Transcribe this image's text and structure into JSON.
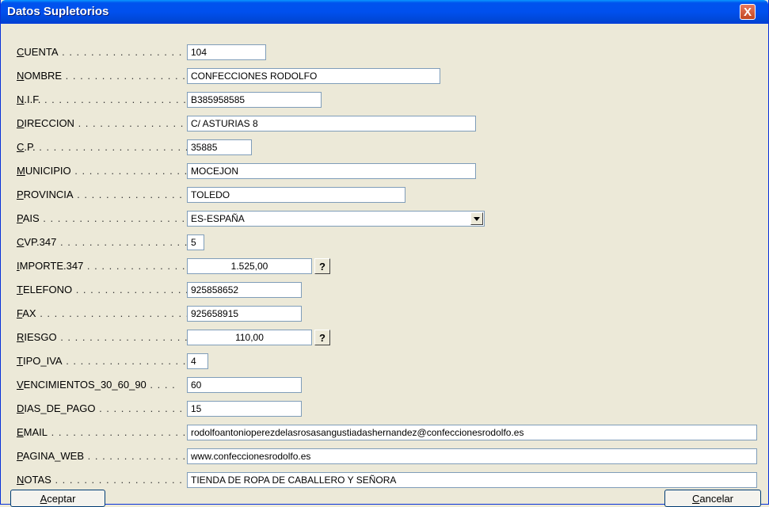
{
  "window": {
    "title": "Datos Supletorios",
    "close_glyph": "X"
  },
  "fields": {
    "cuenta": {
      "label_first": "C",
      "label_rest": "UENTA",
      "value": "104"
    },
    "nombre": {
      "label_first": "N",
      "label_rest": "OMBRE",
      "value": "CONFECCIONES RODOLFO"
    },
    "nif": {
      "label_first": "N",
      "label_rest": ".I.F.",
      "value": "B385958585"
    },
    "direccion": {
      "label_first": "D",
      "label_rest": "IRECCION",
      "value": "C/ ASTURIAS 8"
    },
    "cp": {
      "label_first": "C",
      "label_rest": ".P.",
      "value": "35885"
    },
    "municipio": {
      "label_first": "M",
      "label_rest": "UNICIPIO",
      "value": "MOCEJON"
    },
    "provincia": {
      "label_first": "P",
      "label_rest": "ROVINCIA",
      "value": "TOLEDO"
    },
    "pais": {
      "label_first": "P",
      "label_rest": "AIS",
      "value": "ES-ESPAÑA"
    },
    "cvp347": {
      "label_first": "C",
      "label_rest": "VP.347",
      "value": "5"
    },
    "importe347": {
      "label_first": "I",
      "label_rest": "MPORTE.347",
      "value": "1.525,00"
    },
    "telefono": {
      "label_first": "T",
      "label_rest": "ELEFONO",
      "value": "925858652"
    },
    "fax": {
      "label_first": "F",
      "label_rest": "AX",
      "value": "925658915"
    },
    "riesgo": {
      "label_first": "R",
      "label_rest": "IESGO",
      "value": "110,00"
    },
    "tipo_iva": {
      "label_first": "T",
      "label_rest": "IPO_IVA",
      "value": "4"
    },
    "vencimientos": {
      "label_first": "V",
      "label_rest": "ENCIMIENTOS_30_60_90",
      "value": "60"
    },
    "dias_pago": {
      "label_first": "D",
      "label_rest": "IAS_DE_PAGO",
      "value": "15"
    },
    "email": {
      "label_first": "E",
      "label_rest": "MAIL",
      "value": "rodolfoantonioperezdelasrosasangustiadashernandez@confeccionesrodolfo.es"
    },
    "pagina_web": {
      "label_first": "P",
      "label_rest": "AGINA_WEB",
      "value": "www.confeccionesrodolfo.es"
    },
    "notas": {
      "label_first": "N",
      "label_rest": "OTAS",
      "value": "TIENDA DE ROPA DE CABALLERO Y SEÑORA"
    }
  },
  "help_glyph": "?",
  "buttons": {
    "aceptar": {
      "first": "A",
      "rest": "ceptar"
    },
    "cancelar": {
      "first": "C",
      "rest": "ancelar"
    }
  },
  "icons": {
    "close": "close-icon",
    "dropdown": "chevron-down-icon"
  }
}
